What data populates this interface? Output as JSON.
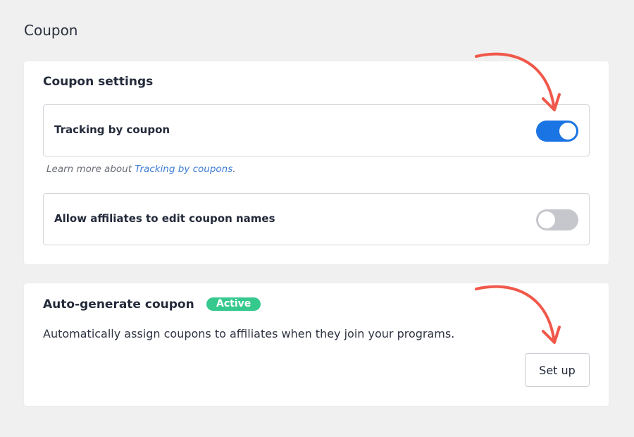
{
  "page": {
    "title": "Coupon"
  },
  "coupon_settings": {
    "title": "Coupon settings",
    "tracking": {
      "label": "Tracking by coupon",
      "enabled": true
    },
    "learn_more_prefix": "Learn more about ",
    "learn_more_link": "Tracking by coupons",
    "learn_more_suffix": ".",
    "edit_names": {
      "label": "Allow affiliates to edit coupon names",
      "enabled": false
    }
  },
  "auto_generate": {
    "title": "Auto-generate coupon",
    "badge": "Active",
    "description": "Automatically assign coupons to affiliates when they join your programs.",
    "button_label": "Set up"
  },
  "colors": {
    "accent": "#1b74e4",
    "badge": "#36c98e",
    "annotation_arrow": "#f0584a"
  }
}
